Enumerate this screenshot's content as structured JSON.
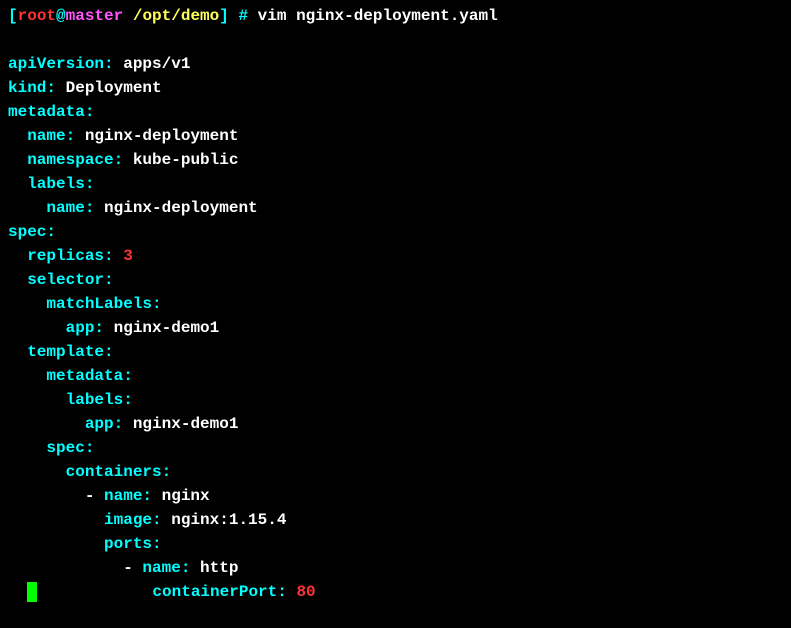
{
  "prompt": {
    "bracket_open": "[",
    "user": "root",
    "at": "@",
    "host": "master",
    "path": " /opt/demo",
    "bracket_close": "]",
    "hash": " # ",
    "command": "vim nginx-deployment.yaml"
  },
  "yaml": {
    "apiVersion_key": "apiVersion",
    "apiVersion_val": "apps/v1",
    "kind_key": "kind",
    "kind_val": "Deployment",
    "metadata_key": "metadata",
    "name_key": "name",
    "name_val": "nginx-deployment",
    "namespace_key": "namespace",
    "namespace_val": "kube-public",
    "labels_key": "labels",
    "labels_name_key": "name",
    "labels_name_val": "nginx-deployment",
    "spec_key": "spec",
    "replicas_key": "replicas",
    "replicas_val": "3",
    "selector_key": "selector",
    "matchLabels_key": "matchLabels",
    "app_key": "app",
    "app_val": "nginx-demo1",
    "template_key": "template",
    "template_metadata_key": "metadata",
    "template_labels_key": "labels",
    "template_app_key": "app",
    "template_app_val": "nginx-demo1",
    "template_spec_key": "spec",
    "containers_key": "containers",
    "container_name_key": "name",
    "container_name_val": "nginx",
    "image_key": "image",
    "image_val": "nginx:1.15.4",
    "ports_key": "ports",
    "port_name_key": "name",
    "port_name_val": "http",
    "containerPort_key": "containerPort",
    "containerPort_val": "80",
    "colon": ":",
    "colon_space": ": ",
    "dash": "- "
  }
}
